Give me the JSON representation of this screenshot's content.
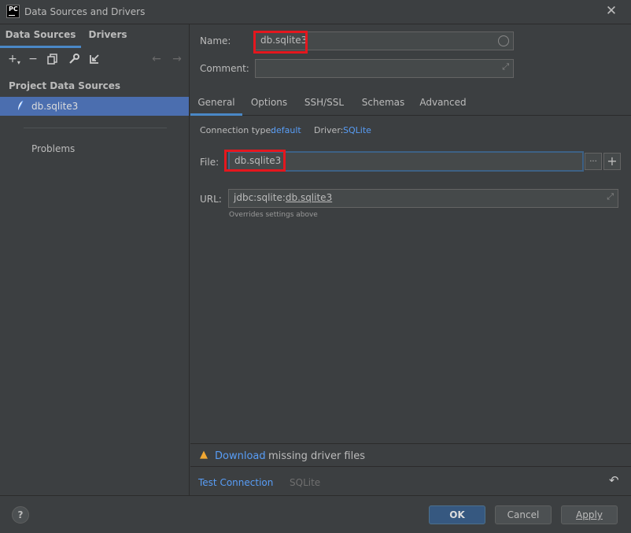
{
  "window": {
    "title": "Data Sources and Drivers",
    "app_icon_text": "PC"
  },
  "left": {
    "tabs": [
      {
        "label": "Data Sources"
      },
      {
        "label": "Drivers"
      }
    ],
    "section_title": "Project Data Sources",
    "selected_item": "db.sqlite3",
    "problems_label": "Problems"
  },
  "right": {
    "name_label": "Name:",
    "name_value": "db.sqlite3",
    "comment_label": "Comment:",
    "comment_value": "",
    "tabs": [
      {
        "label": "General"
      },
      {
        "label": "Options"
      },
      {
        "label": "SSH/SSL"
      },
      {
        "label": "Schemas"
      },
      {
        "label": "Advanced"
      }
    ],
    "conn_type_label": "Connection type:",
    "conn_type_value": "default",
    "driver_label": "Driver:",
    "driver_value": "SQLite",
    "file_label": "File:",
    "file_value": "db.sqlite3",
    "browse_label": "...",
    "add_label": "+",
    "url_label": "URL:",
    "url_prefix": "jdbc:sqlite:",
    "url_file": "db.sqlite3",
    "url_note": "Overrides settings above",
    "download_link": "Download",
    "download_text": "missing driver files",
    "test_connection": "Test Connection",
    "test_driver": "SQLite"
  },
  "buttons": {
    "ok": "OK",
    "cancel": "Cancel",
    "apply": "Apply",
    "help": "?"
  },
  "colors": {
    "accent": "#4a88c7",
    "selection": "#4b6eaf",
    "link": "#589df6",
    "highlight": "#e4171e",
    "warning": "#f0a732"
  }
}
